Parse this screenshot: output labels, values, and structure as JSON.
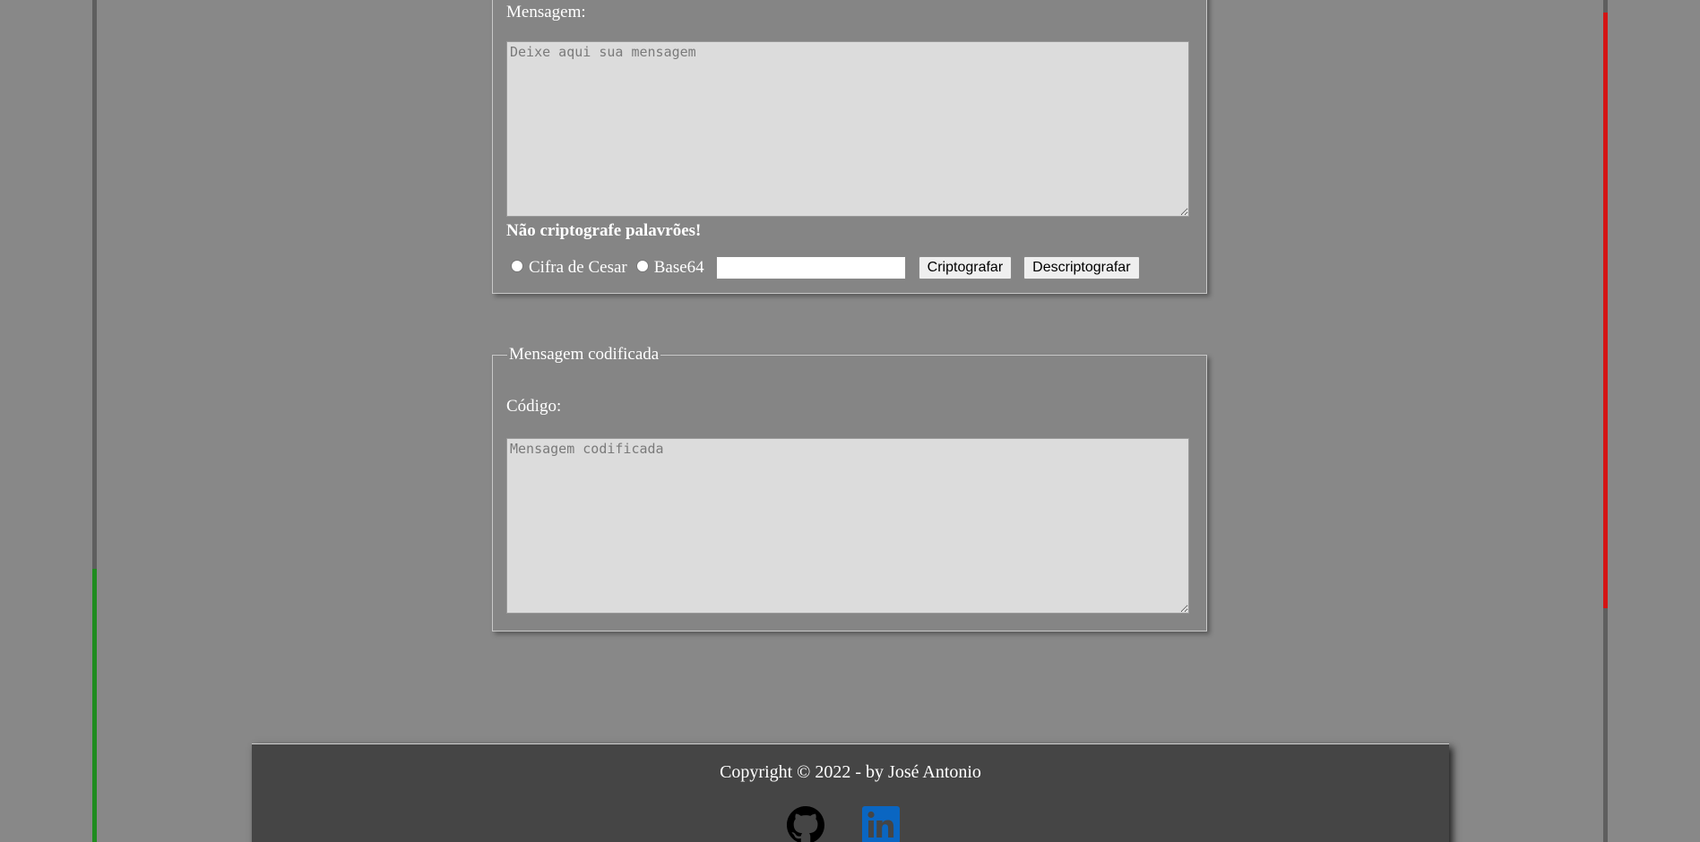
{
  "left_accent_color": "#1f8c1f",
  "right_accent_color": "#d41414",
  "form": {
    "message_label": "Mensagem:",
    "message_placeholder": "Deixe aqui sua mensagem",
    "warning": "Não criptografe palavrões!",
    "options": [
      {
        "label": "Cifra de Cesar",
        "selected": false
      },
      {
        "label": "Base64",
        "selected": false
      }
    ],
    "key_value": "",
    "encrypt_label": "Criptografar",
    "decrypt_label": "Descriptografar"
  },
  "output": {
    "legend": "Mensagem codificada",
    "code_label": "Código:",
    "code_placeholder": "Mensagem codificada"
  },
  "footer": {
    "copyright": "Copyright © 2022 - by José Antonio",
    "icons": [
      "github-icon",
      "linkedin-icon"
    ],
    "linkedin_color": "#0a66c2"
  }
}
